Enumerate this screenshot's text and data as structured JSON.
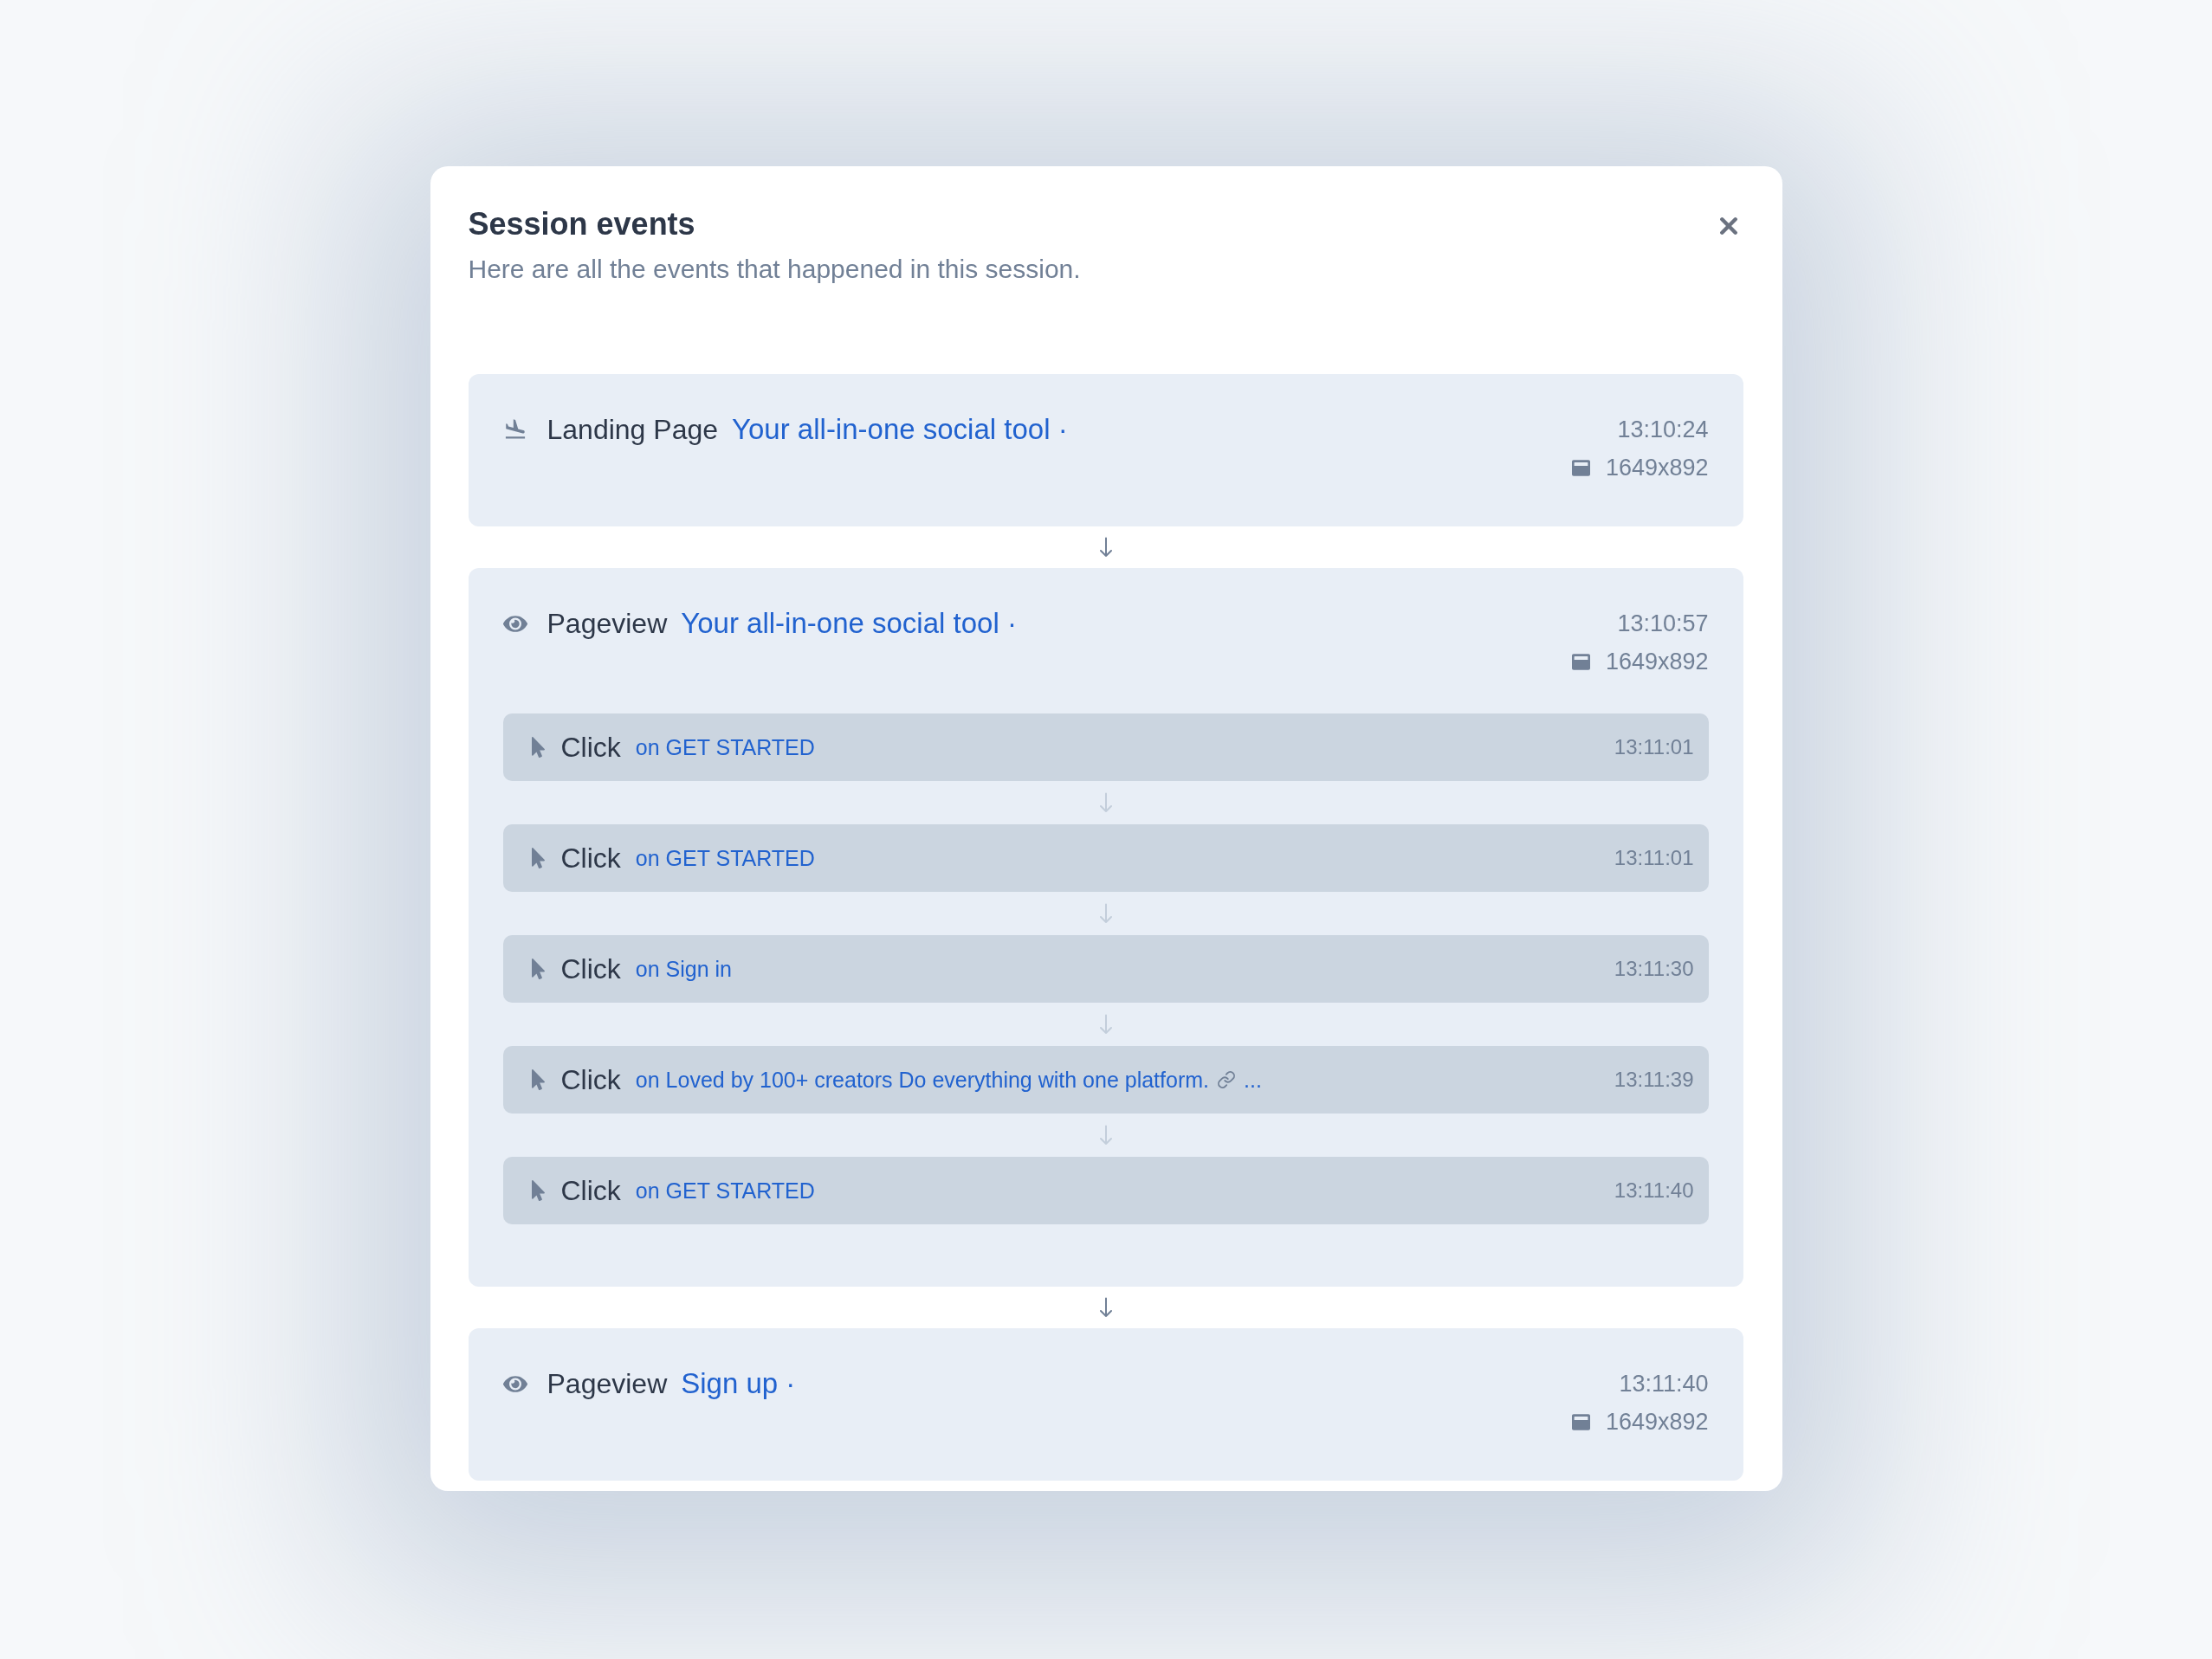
{
  "dialog": {
    "title": "Session events",
    "subtitle": "Here are all the events that happened in this session."
  },
  "events": [
    {
      "kind": "landing",
      "label": "Landing Page",
      "page_title": "Your all-in-one social tool ·",
      "time": "13:10:24",
      "resolution": "1649x892"
    },
    {
      "kind": "pageview",
      "label": "Pageview",
      "page_title": "Your all-in-one social tool ·",
      "time": "13:10:57",
      "resolution": "1649x892",
      "children": [
        {
          "kind": "click",
          "label": "Click",
          "target": "on GET STARTED",
          "link_icon": false,
          "time": "13:11:01"
        },
        {
          "kind": "click",
          "label": "Click",
          "target": "on GET STARTED",
          "link_icon": false,
          "time": "13:11:01"
        },
        {
          "kind": "click",
          "label": "Click",
          "target": "on Sign in",
          "link_icon": false,
          "time": "13:11:30"
        },
        {
          "kind": "click",
          "label": "Click",
          "target": "on Loved by 100+ creators Do everything with one platform.",
          "link_icon": true,
          "target_tail": "...",
          "time": "13:11:39"
        },
        {
          "kind": "click",
          "label": "Click",
          "target": "on GET STARTED",
          "link_icon": false,
          "time": "13:11:40"
        }
      ]
    },
    {
      "kind": "pageview",
      "label": "Pageview",
      "page_title": "Sign up ·",
      "time": "13:11:40",
      "resolution": "1649x892"
    }
  ]
}
